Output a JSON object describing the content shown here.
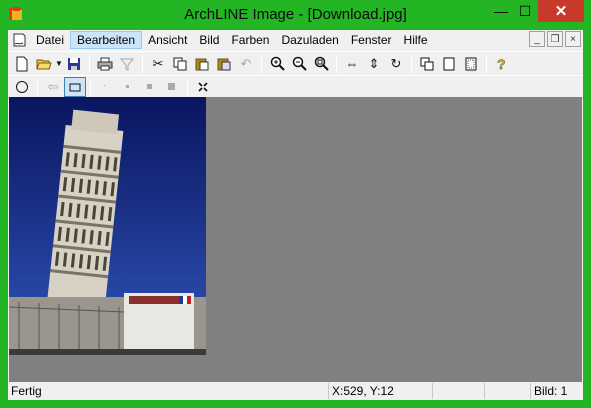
{
  "window": {
    "title": "ArchLINE Image - [Download.jpg]",
    "close_glyph": "✕",
    "minimize_glyph": "—",
    "maximize_glyph": "☐"
  },
  "menubar": {
    "items": [
      "Datei",
      "Bearbeiten",
      "Ansicht",
      "Bild",
      "Farben",
      "Dazuladen",
      "Fenster",
      "Hilfe"
    ],
    "active_index": 1,
    "mdi_minimize": "_",
    "mdi_restore": "❐",
    "mdi_close": "×"
  },
  "toolbar1": {
    "icons": [
      "new-icon",
      "open-icon",
      "save-icon",
      "print-icon",
      "filter-icon",
      "cut-icon",
      "copy-icon",
      "paste-icon",
      "paste-special-icon",
      "undo-icon",
      "zoom-in-icon",
      "zoom-out-icon",
      "zoom-fit-icon",
      "flip-horizontal-icon",
      "flip-vertical-icon",
      "rotate-icon",
      "copy-window-icon",
      "page-icon",
      "page-alt-icon",
      "help-icon"
    ]
  },
  "toolbar2": {
    "icons": [
      "circle-select-icon",
      "back-arrow-icon",
      "rect-select-icon",
      "dot-tiny-icon",
      "dot-small-icon",
      "dot-medium-icon",
      "dot-large-icon",
      "crosshair-icon"
    ]
  },
  "statusbar": {
    "status": "Fertig",
    "coords": "X:529, Y:12",
    "image_label": "Bild: 1"
  },
  "colors": {
    "frame": "#23b523",
    "close_button": "#c7392b",
    "canvas": "#808080",
    "active_menu": "#cce4f7"
  }
}
